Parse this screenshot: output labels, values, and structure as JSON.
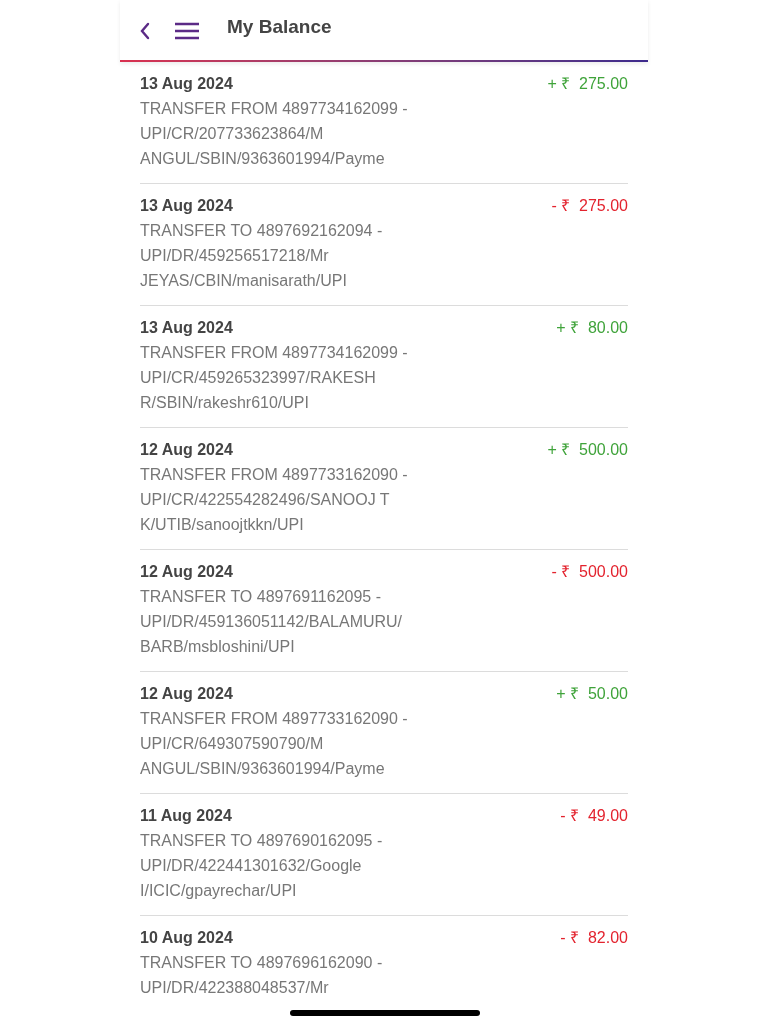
{
  "header": {
    "title": "My Balance"
  },
  "transactions": [
    {
      "date": "13 Aug 2024",
      "amount": "+ ₹  275.00",
      "kind": "credit",
      "description": [
        "TRANSFER FROM 4897734162099 -",
        "UPI/CR/207733623864/M",
        "ANGUL/SBIN/9363601994/Payme"
      ]
    },
    {
      "date": "13 Aug 2024",
      "amount": "- ₹  275.00",
      "kind": "debit",
      "description": [
        "TRANSFER TO 4897692162094 -",
        "UPI/DR/459256517218/Mr",
        "JEYAS/CBIN/manisarath/UPI"
      ]
    },
    {
      "date": "13 Aug 2024",
      "amount": "+ ₹  80.00",
      "kind": "credit",
      "description": [
        "TRANSFER FROM 4897734162099 -",
        "UPI/CR/459265323997/RAKESH",
        "R/SBIN/rakeshr610/UPI"
      ]
    },
    {
      "date": "12 Aug 2024",
      "amount": "+ ₹  500.00",
      "kind": "credit",
      "description": [
        "TRANSFER FROM 4897733162090 -",
        "UPI/CR/422554282496/SANOOJ T",
        "K/UTIB/sanoojtkkn/UPI"
      ]
    },
    {
      "date": "12 Aug 2024",
      "amount": "- ₹  500.00",
      "kind": "debit",
      "description": [
        "TRANSFER TO 4897691162095 -",
        "UPI/DR/459136051142/BALAMURU/",
        "BARB/msbloshini/UPI"
      ]
    },
    {
      "date": "12 Aug 2024",
      "amount": "+ ₹  50.00",
      "kind": "credit",
      "description": [
        "TRANSFER FROM 4897733162090 -",
        "UPI/CR/649307590790/M",
        "ANGUL/SBIN/9363601994/Payme"
      ]
    },
    {
      "date": "11 Aug 2024",
      "amount": "- ₹  49.00",
      "kind": "debit",
      "description": [
        "TRANSFER TO 4897690162095 -",
        "UPI/DR/422441301632/Google",
        "I/ICIC/gpayrechar/UPI"
      ]
    },
    {
      "date": "10 Aug 2024",
      "amount": "- ₹  82.00",
      "kind": "debit",
      "description": [
        "TRANSFER TO 4897696162090 -",
        "UPI/DR/422388048537/Mr"
      ]
    }
  ]
}
